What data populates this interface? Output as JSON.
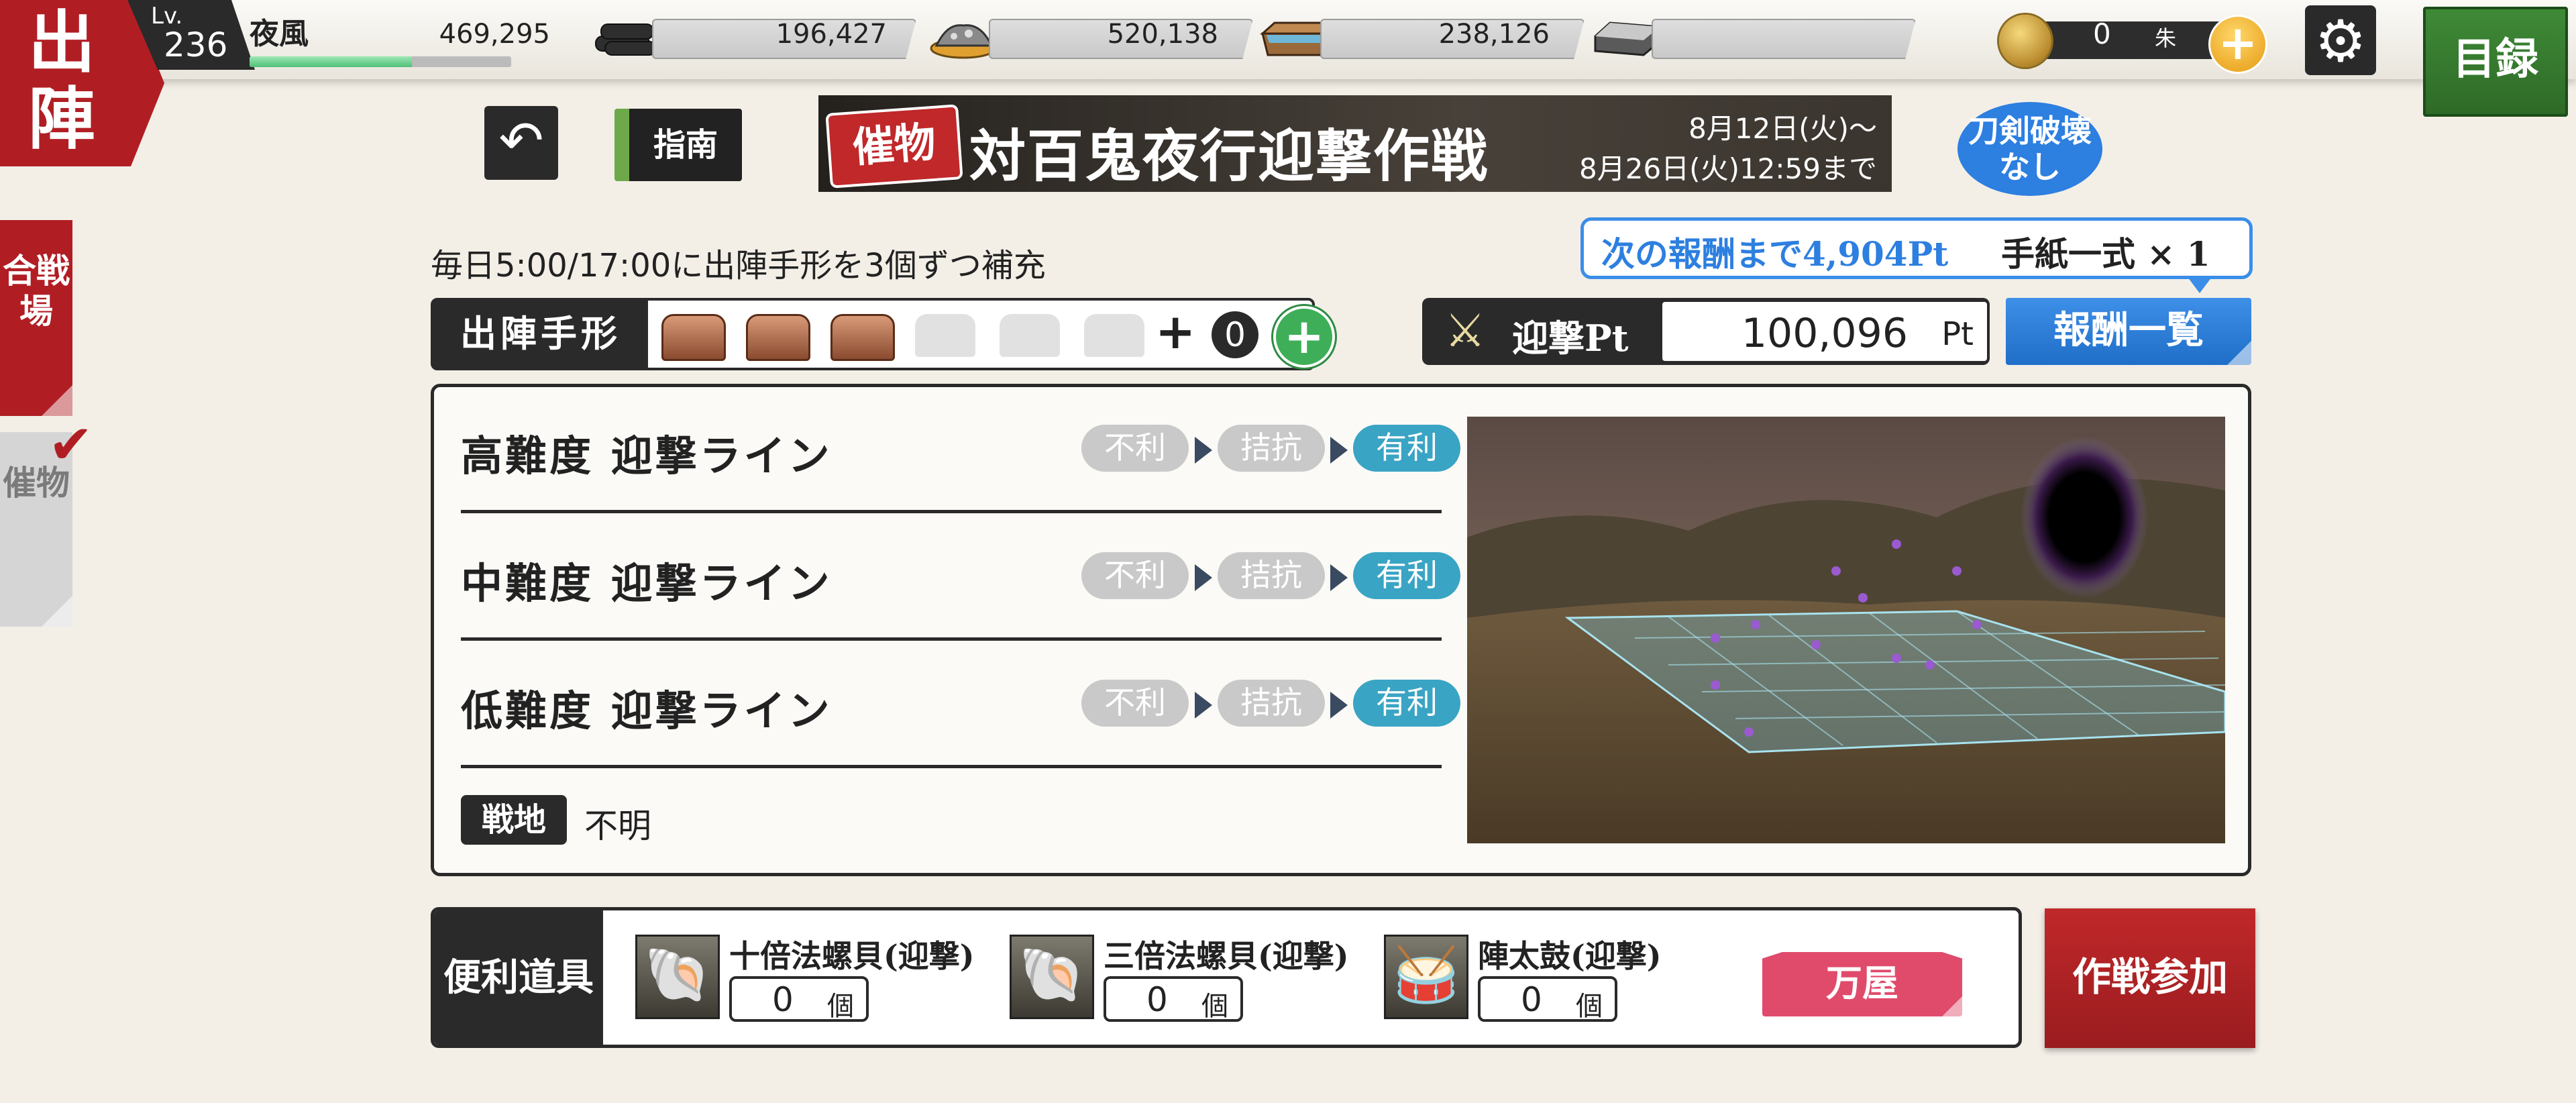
{
  "header": {
    "sortie_label": "出陣",
    "level_label": "Lv.",
    "level": "236",
    "player_name": "夜風",
    "exp_progress": 0.62
  },
  "resources": [
    {
      "icon": "charcoal-icon",
      "value": "469,295"
    },
    {
      "icon": "steel-icon",
      "value": "196,427"
    },
    {
      "icon": "cooling-material-icon",
      "value": "520,138"
    },
    {
      "icon": "whetstone-icon",
      "value": "238,126"
    }
  ],
  "currency": {
    "icon": "koban-coin-icon",
    "value": "0",
    "unit": "朱",
    "add_label": "+"
  },
  "catalog_label": "目録",
  "side_tabs": [
    {
      "label": "合戦場",
      "active": true
    },
    {
      "label": "催物",
      "active": false,
      "checked": true
    }
  ],
  "guide_label": "指南",
  "banner": {
    "tag": "催物",
    "title": "対百鬼夜行迎撃作戦",
    "start": "8月12日(火)〜",
    "end": "8月26日(火)12:59まで"
  },
  "no_break_label": "刀剣破壊なし",
  "refill_text": "毎日5:00/17:00に出陣手形を3個ずつ補充",
  "next_reward": {
    "text": "次の報酬まで4,904Pt",
    "item": "手紙一式 × 1"
  },
  "sortie_pass": {
    "label": "出陣手形",
    "filled": 3,
    "total": 6,
    "plus": "+",
    "extra": "0",
    "add_label": "+"
  },
  "intercept_points": {
    "label": "迎撃Pt",
    "value": "100,096",
    "unit": "Pt"
  },
  "reward_list_label": "報酬一覧",
  "lines": [
    {
      "name": "高難度 迎撃ライン",
      "statuses": [
        "不利",
        "拮抗",
        "有利"
      ],
      "active_index": 2
    },
    {
      "name": "中難度 迎撃ライン",
      "statuses": [
        "不利",
        "拮抗",
        "有利"
      ],
      "active_index": 2
    },
    {
      "name": "低難度 迎撃ライン",
      "statuses": [
        "不利",
        "拮抗",
        "有利"
      ],
      "active_index": 2
    }
  ],
  "battlefield": {
    "label": "戦地",
    "value": "不明"
  },
  "items": {
    "label": "便利道具",
    "list": [
      {
        "name": "十倍法螺貝(迎撃)",
        "count": "0",
        "unit": "個",
        "icon": "conch-shell-icon"
      },
      {
        "name": "三倍法螺貝(迎撃)",
        "count": "0",
        "unit": "個",
        "icon": "conch-shell-icon"
      },
      {
        "name": "陣太鼓(迎撃)",
        "count": "0",
        "unit": "個",
        "icon": "war-drum-icon"
      }
    ],
    "shop_label": "万屋"
  },
  "join_label": "作戦参加",
  "colors": {
    "brand_red": "#b01e24",
    "accent_blue": "#2d7fe0",
    "advantage": "#3aa4c4"
  }
}
